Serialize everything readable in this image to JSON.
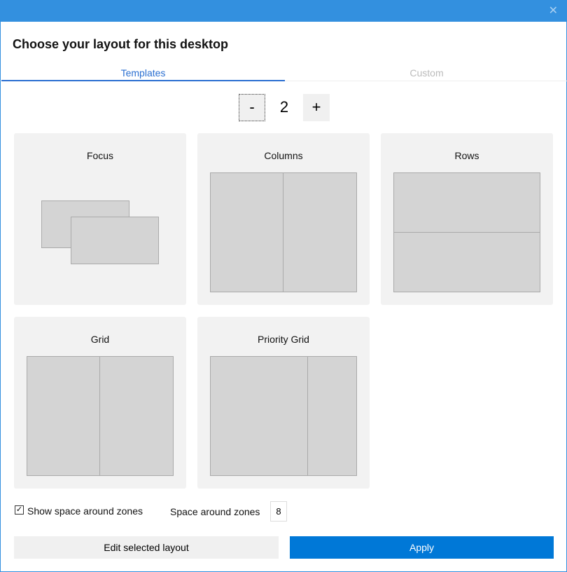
{
  "window": {
    "close_icon": "close-icon"
  },
  "header": {
    "title": "Choose your layout for this desktop"
  },
  "tabs": [
    {
      "label": "Templates",
      "active": true
    },
    {
      "label": "Custom",
      "active": false
    }
  ],
  "zone_count": {
    "minus": "-",
    "value": "2",
    "plus": "+"
  },
  "templates": [
    {
      "label": "Focus"
    },
    {
      "label": "Columns"
    },
    {
      "label": "Rows"
    },
    {
      "label": "Grid"
    },
    {
      "label": "Priority Grid"
    }
  ],
  "options": {
    "show_space_label": "Show space around zones",
    "show_space_checked": true,
    "space_label": "Space around zones",
    "space_value": "8"
  },
  "buttons": {
    "edit": "Edit selected layout",
    "apply": "Apply"
  },
  "colors": {
    "titlebar": "#3390df",
    "accent": "#0078d7"
  }
}
